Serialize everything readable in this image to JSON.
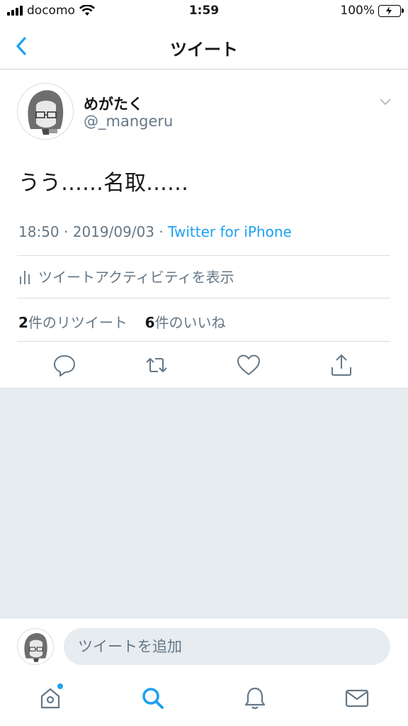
{
  "status_bar": {
    "carrier": "docomo",
    "time": "1:59",
    "battery": "100%"
  },
  "nav": {
    "title": "ツイート"
  },
  "tweet": {
    "display_name": "めがたく",
    "handle": "@_mangeru",
    "text": "うう……名取……",
    "time": "18:50",
    "separator1": " · ",
    "date": "2019/09/03",
    "separator2": " · ",
    "source": "Twitter for iPhone",
    "activity_label": "ツイートアクティビティを表示",
    "retweet_count": "2",
    "retweet_label": "件のリツイート",
    "like_count": "6",
    "like_label": "件のいいね"
  },
  "reply": {
    "placeholder": "ツイートを追加"
  },
  "colors": {
    "accent": "#1da1f2",
    "secondary_text": "#657786",
    "background_gray": "#e6ecf0"
  },
  "icons": {
    "back": "chevron-left-icon",
    "caret": "chevron-down-icon",
    "activity": "bar-chart-icon",
    "reply": "reply-bubble-icon",
    "retweet": "retweet-icon",
    "like": "heart-icon",
    "share": "share-icon",
    "home": "home-icon",
    "search": "search-icon",
    "notifications": "bell-icon",
    "messages": "envelope-icon"
  }
}
